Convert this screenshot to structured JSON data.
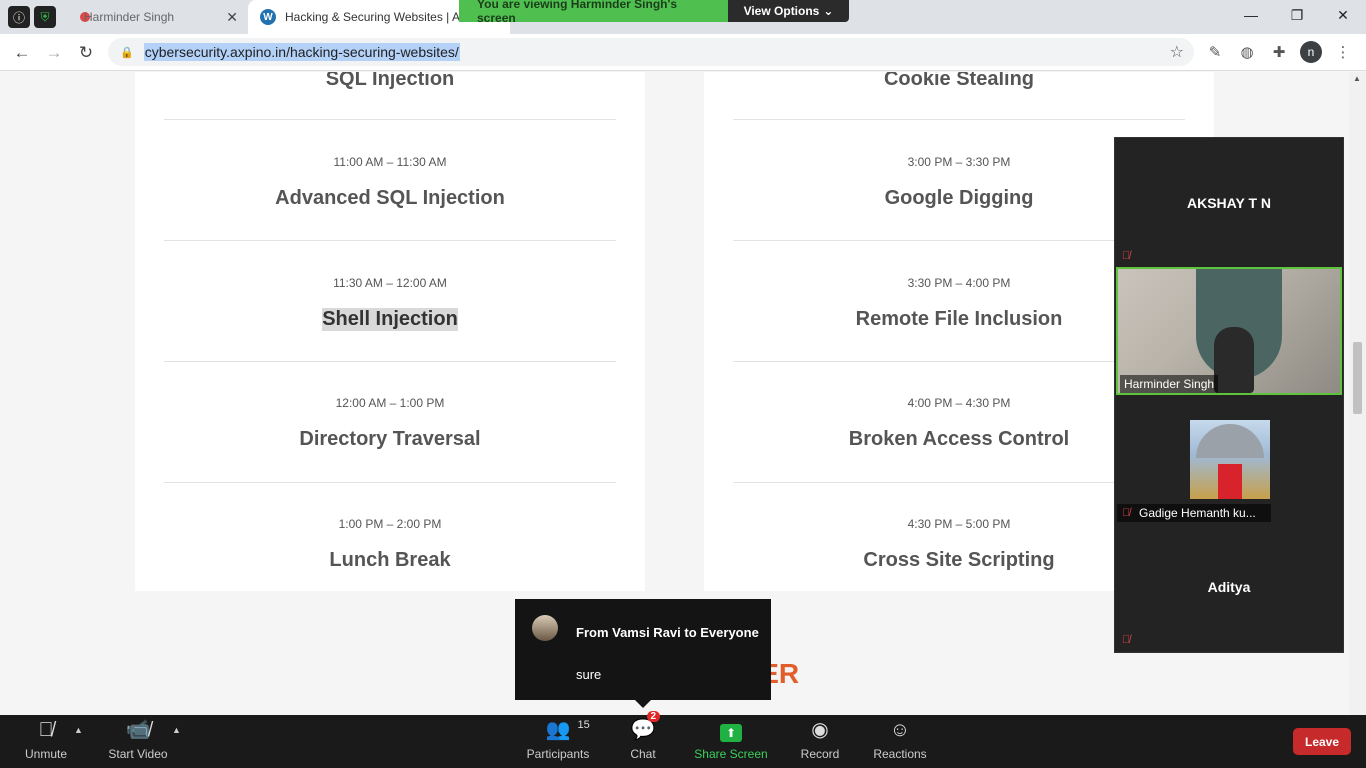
{
  "browser": {
    "tabs": [
      {
        "title": "Harminder Singh",
        "active": false
      },
      {
        "title": "Hacking & Securing Websites | A",
        "active": true
      }
    ],
    "url": "cybersecurity.axpino.in/hacking-securing-websites/"
  },
  "zoom_banner": {
    "text": "You are viewing Harminder Singh's screen",
    "view_options": "View Options"
  },
  "schedule": {
    "left": [
      {
        "time": "",
        "title": "SQL Injection"
      },
      {
        "time": "11:00 AM – 11:30 AM",
        "title": "Advanced SQL Injection"
      },
      {
        "time": "11:30 AM – 12:00 AM",
        "title": "Shell Injection",
        "highlighted": true
      },
      {
        "time": "12:00 AM – 1:00 PM",
        "title": "Directory Traversal"
      },
      {
        "time": "1:00 PM – 2:00 PM",
        "title": "Lunch Break"
      }
    ],
    "right": [
      {
        "time": "",
        "title": "Cookie Stealing"
      },
      {
        "time": "3:00 PM – 3:30 PM",
        "title": "Google Digging"
      },
      {
        "time": "3:30 PM – 4:00 PM",
        "title": "Remote File Inclusion"
      },
      {
        "time": "4:00 PM – 4:30 PM",
        "title": "Broken Access Control"
      },
      {
        "time": "4:30 PM – 5:00 PM",
        "title": "Cross Site Scripting"
      }
    ],
    "partner_fragment": "NER"
  },
  "participants_panel": {
    "top_name": "AKSHAY T N",
    "active_speaker": "Harminder Singh",
    "thumb_name": "Gadige Hemanth ku...",
    "bottom_name": "Aditya"
  },
  "chat_popup": {
    "from": "From Vamsi Ravi to Everyone",
    "message": "sure"
  },
  "zoom_toolbar": {
    "unmute": "Unmute",
    "start_video": "Start Video",
    "participants": "Participants",
    "participants_count": "15",
    "chat": "Chat",
    "chat_badge": "2",
    "share_screen": "Share Screen",
    "record": "Record",
    "reactions": "Reactions",
    "leave": "Leave"
  }
}
